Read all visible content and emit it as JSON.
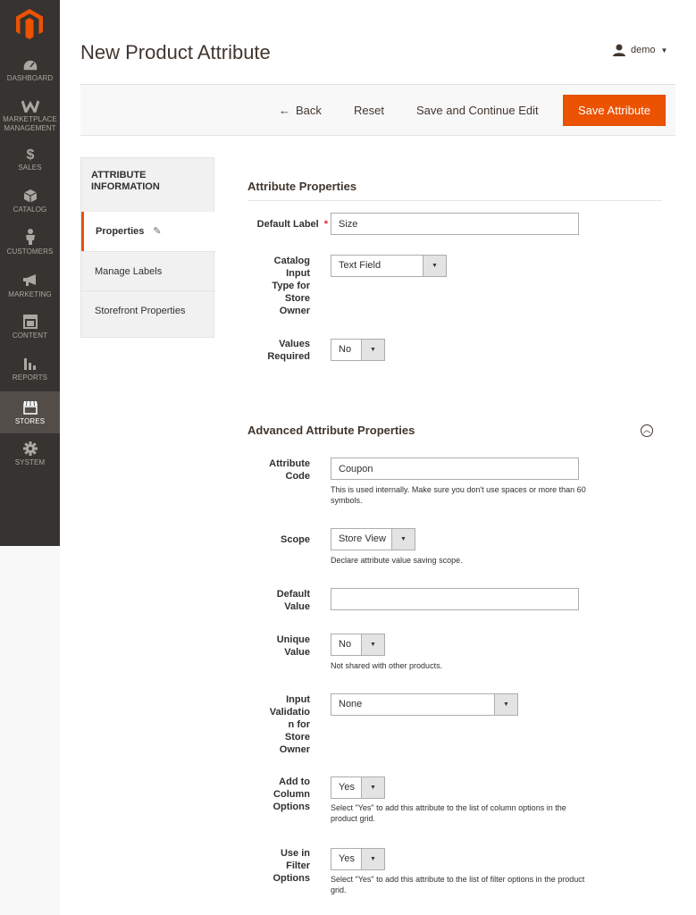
{
  "nav": {
    "items": [
      {
        "label": "DASHBOARD"
      },
      {
        "label": "MARKETPLACE MANAGEMENT"
      },
      {
        "label": "SALES"
      },
      {
        "label": "CATALOG"
      },
      {
        "label": "CUSTOMERS"
      },
      {
        "label": "MARKETING"
      },
      {
        "label": "CONTENT"
      },
      {
        "label": "REPORTS"
      },
      {
        "label": "STORES"
      },
      {
        "label": "SYSTEM"
      }
    ],
    "active": "STORES"
  },
  "header": {
    "title": "New Product Attribute",
    "user": "demo"
  },
  "actions": {
    "back": "Back",
    "reset": "Reset",
    "save_continue": "Save and Continue Edit",
    "save": "Save Attribute"
  },
  "tabs": {
    "title": "ATTRIBUTE INFORMATION",
    "items": [
      {
        "label": "Properties"
      },
      {
        "label": "Manage Labels"
      },
      {
        "label": "Storefront Properties"
      }
    ]
  },
  "properties": {
    "title": "Attribute Properties",
    "default_label": {
      "label": "Default Label",
      "required_mark": "*",
      "value": "Size"
    },
    "input_type": {
      "label": "Catalog Input Type for Store Owner",
      "value": "Text Field"
    },
    "values_required": {
      "label": "Values Required",
      "value": "No"
    }
  },
  "advanced": {
    "title": "Advanced Attribute Properties",
    "attribute_code": {
      "label": "Attribute Code",
      "value": "Coupon",
      "note": "This is used internally. Make sure you don't use spaces or more than 60 symbols."
    },
    "scope": {
      "label": "Scope",
      "value": "Store View",
      "note": "Declare attribute value saving scope."
    },
    "default_value": {
      "label": "Default Value",
      "value": ""
    },
    "unique_value": {
      "label": "Unique Value",
      "value": "No",
      "note": "Not shared with other products."
    },
    "input_validation": {
      "label": "Input Validation for Store Owner",
      "value": "None"
    },
    "add_to_column": {
      "label": "Add to Column Options",
      "value": "Yes",
      "note": "Select \"Yes\" to add this attribute to the list of column options in the product grid."
    },
    "use_in_filter": {
      "label": "Use in Filter Options",
      "value": "Yes",
      "note": "Select \"Yes\" to add this attribute to the list of filter options in the product grid."
    }
  },
  "colors": {
    "accent": "#eb5202",
    "nav_bg": "#373330",
    "nav_active": "#524d49"
  }
}
